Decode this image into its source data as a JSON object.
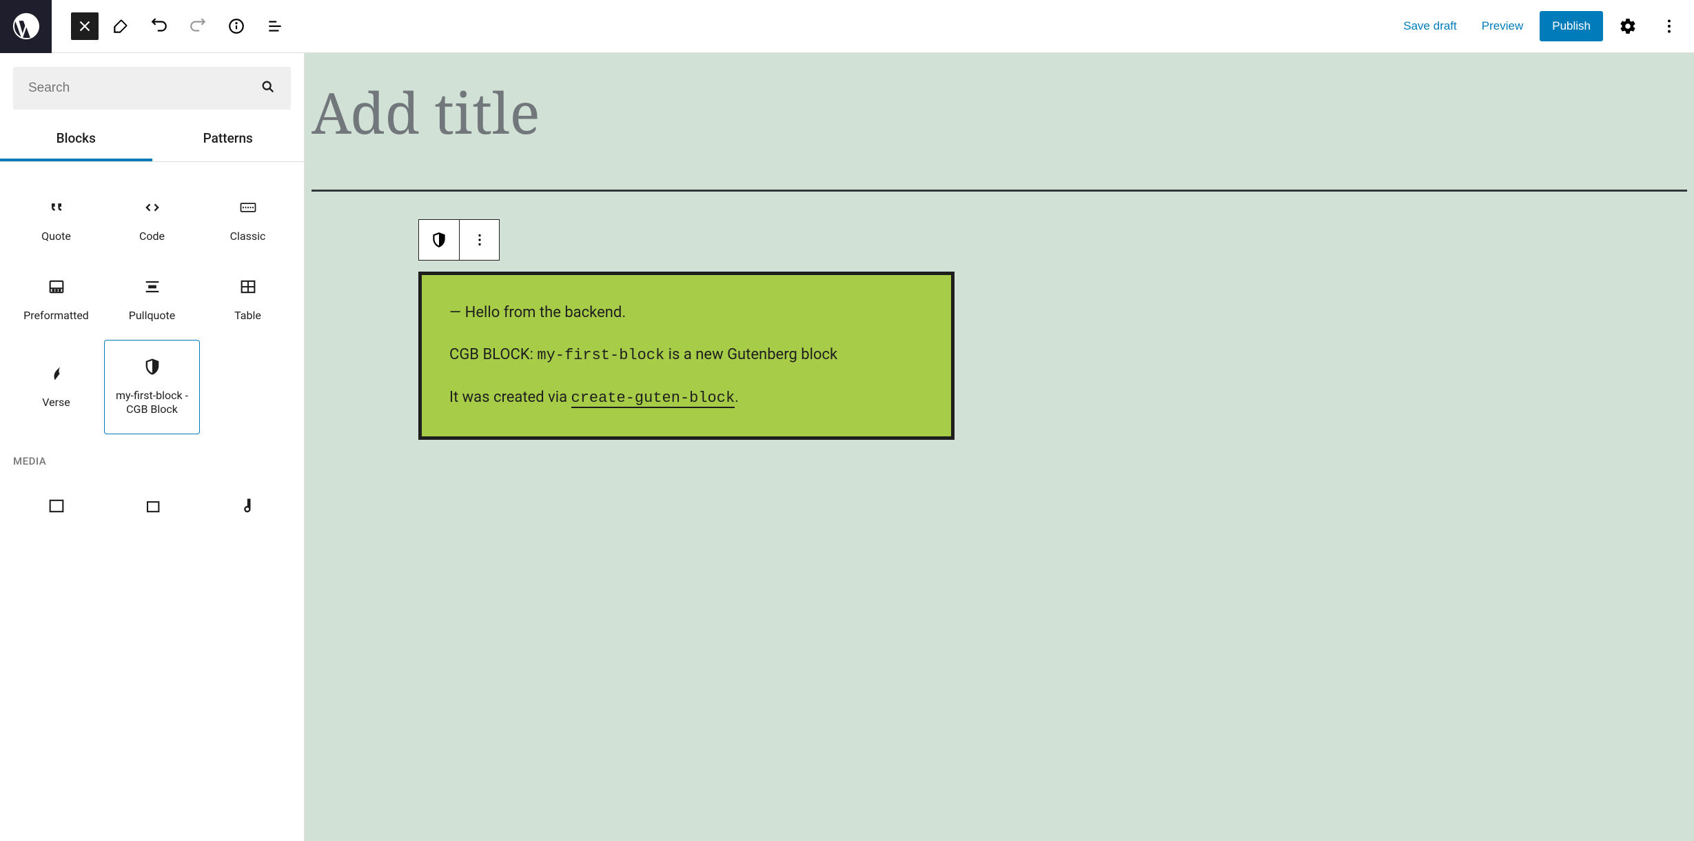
{
  "header": {
    "save_draft": "Save draft",
    "preview": "Preview",
    "publish": "Publish"
  },
  "sidebar": {
    "search_placeholder": "Search",
    "tabs": {
      "blocks": "Blocks",
      "patterns": "Patterns"
    },
    "blocks": [
      {
        "label": "Quote"
      },
      {
        "label": "Code"
      },
      {
        "label": "Classic"
      },
      {
        "label": "Preformatted"
      },
      {
        "label": "Pullquote"
      },
      {
        "label": "Table"
      },
      {
        "label": "Verse"
      },
      {
        "label": "my-first-block - CGB Block"
      }
    ],
    "cat_media": "MEDIA"
  },
  "canvas": {
    "title_placeholder": "Add title",
    "block": {
      "line1": "— Hello from the backend.",
      "line2_a": "CGB BLOCK: ",
      "line2_code": "my-first-block",
      "line2_b": " is a new Gutenberg block",
      "line3_a": "It was created via ",
      "line3_code": "create-guten-block",
      "line3_b": "."
    }
  }
}
